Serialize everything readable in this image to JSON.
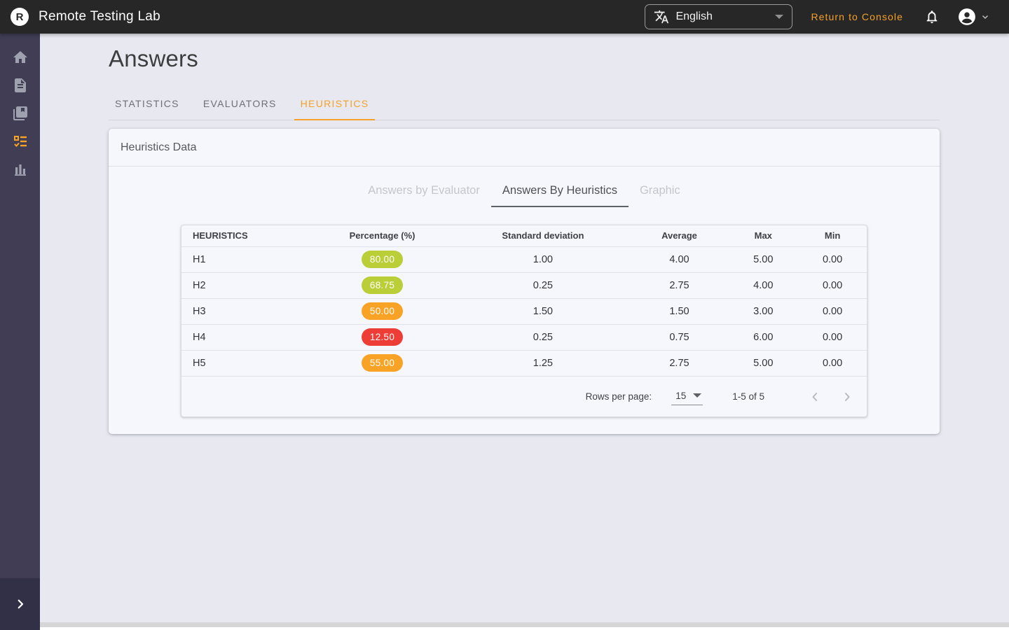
{
  "topbar": {
    "logo_letter": "R",
    "app_name": "Remote Testing Lab",
    "language": {
      "selected": "English",
      "icon": "translate-icon"
    },
    "return_link_label": "Return to Console",
    "icons": [
      "notifications-bell-icon",
      "account-circle-icon",
      "chevron-down-icon"
    ]
  },
  "sidebar": {
    "items": [
      {
        "name": "home",
        "icon": "home-icon",
        "active": false
      },
      {
        "name": "documents",
        "icon": "document-icon",
        "active": false
      },
      {
        "name": "library",
        "icon": "library-books-icon",
        "active": false
      },
      {
        "name": "heuristics",
        "icon": "checklist-icon",
        "active": true
      },
      {
        "name": "statistics",
        "icon": "bar-chart-icon",
        "active": false
      }
    ],
    "expand_icon": "chevron-right-icon"
  },
  "page": {
    "title": "Answers",
    "tabs": [
      {
        "label": "STATISTICS",
        "active": false
      },
      {
        "label": "EVALUATORS",
        "active": false
      },
      {
        "label": "HEURISTICS",
        "active": true
      }
    ]
  },
  "card": {
    "title": "Heuristics Data",
    "subtabs": [
      {
        "label": "Answers by Evaluator",
        "active": false
      },
      {
        "label": "Answers By Heuristics",
        "active": true
      },
      {
        "label": "Graphic",
        "active": false
      }
    ]
  },
  "table": {
    "columns": [
      "HEURISTICS",
      "Percentage (%)",
      "Standard deviation",
      "Average",
      "Max",
      "Min"
    ],
    "rows": [
      {
        "heuristic": "H1",
        "percentage": "80.00",
        "badge_color": "#bace38",
        "std": "1.00",
        "avg": "4.00",
        "max": "5.00",
        "min": "0.00"
      },
      {
        "heuristic": "H2",
        "percentage": "68.75",
        "badge_color": "#bace38",
        "std": "0.25",
        "avg": "2.75",
        "max": "4.00",
        "min": "0.00"
      },
      {
        "heuristic": "H3",
        "percentage": "50.00",
        "badge_color": "#f9a326",
        "std": "1.50",
        "avg": "1.50",
        "max": "3.00",
        "min": "0.00"
      },
      {
        "heuristic": "H4",
        "percentage": "12.50",
        "badge_color": "#ee3d36",
        "std": "0.25",
        "avg": "0.75",
        "max": "6.00",
        "min": "0.00"
      },
      {
        "heuristic": "H5",
        "percentage": "55.00",
        "badge_color": "#f9a326",
        "std": "1.25",
        "avg": "2.75",
        "max": "5.00",
        "min": "0.00"
      }
    ],
    "pagination": {
      "rows_per_page_label": "Rows per page:",
      "rows_per_page_value": "15",
      "range_label": "1-5 of 5",
      "icons": [
        "chevron-left-icon",
        "chevron-right-icon"
      ]
    }
  },
  "colors": {
    "accent_orange": "#f5a028",
    "badge_green": "#bace38",
    "badge_orange": "#f9a326",
    "badge_red": "#ee3d36",
    "topbar_bg": "#272727",
    "sidebar_bg": "#403d54"
  }
}
